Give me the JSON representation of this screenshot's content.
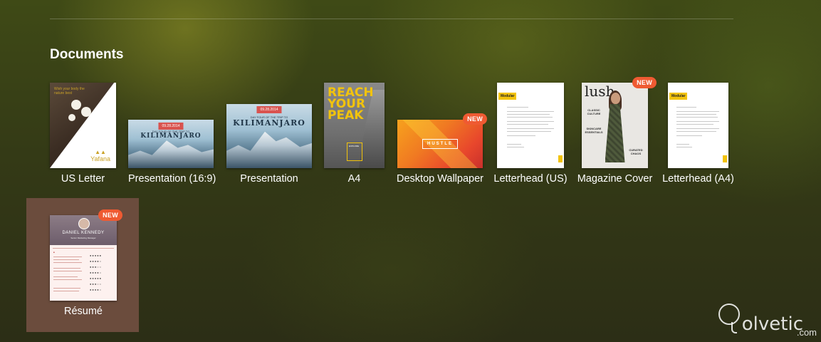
{
  "section": {
    "title": "Documents"
  },
  "templates": [
    {
      "label": "US Letter",
      "thumb_text": "Yafana",
      "thumb_small": "Wish your body the nature best"
    },
    {
      "label": "Presentation (16:9)",
      "thumb_date": "09.28.2014",
      "thumb_sub": "DAY FOUR OF THE TRIP TO",
      "thumb_title": "KILIMANJARO"
    },
    {
      "label": "Presentation",
      "thumb_date": "09.28.2014",
      "thumb_sub": "DAY FOUR OF THE TRIP TO",
      "thumb_title": "KILIMANJARO"
    },
    {
      "label": "A4",
      "thumb_title": "REACH YOUR PEAK",
      "thumb_box": "EXPLORE"
    },
    {
      "label": "Desktop Wallpaper",
      "badge": "NEW",
      "thumb_title": "HUSTLE"
    },
    {
      "label": "Letterhead (US)",
      "thumb_logo": "Modular"
    },
    {
      "label": "Magazine Cover",
      "badge": "NEW",
      "thumb_title": "lush",
      "thumb_left": "CLASSIC CULTURE",
      "thumb_left2": "SKINCARE ESSENTIALS",
      "thumb_left3": "CURATED CHAOS"
    },
    {
      "label": "Letterhead (A4)",
      "thumb_logo": "Modular"
    },
    {
      "label": "Résumé",
      "badge": "NEW",
      "selected": true,
      "thumb_name": "DANIEL KENNEDY",
      "thumb_sub": "Senior Marketing Manager"
    }
  ],
  "brand": {
    "word": "olvetic",
    "suffix": ".com"
  }
}
